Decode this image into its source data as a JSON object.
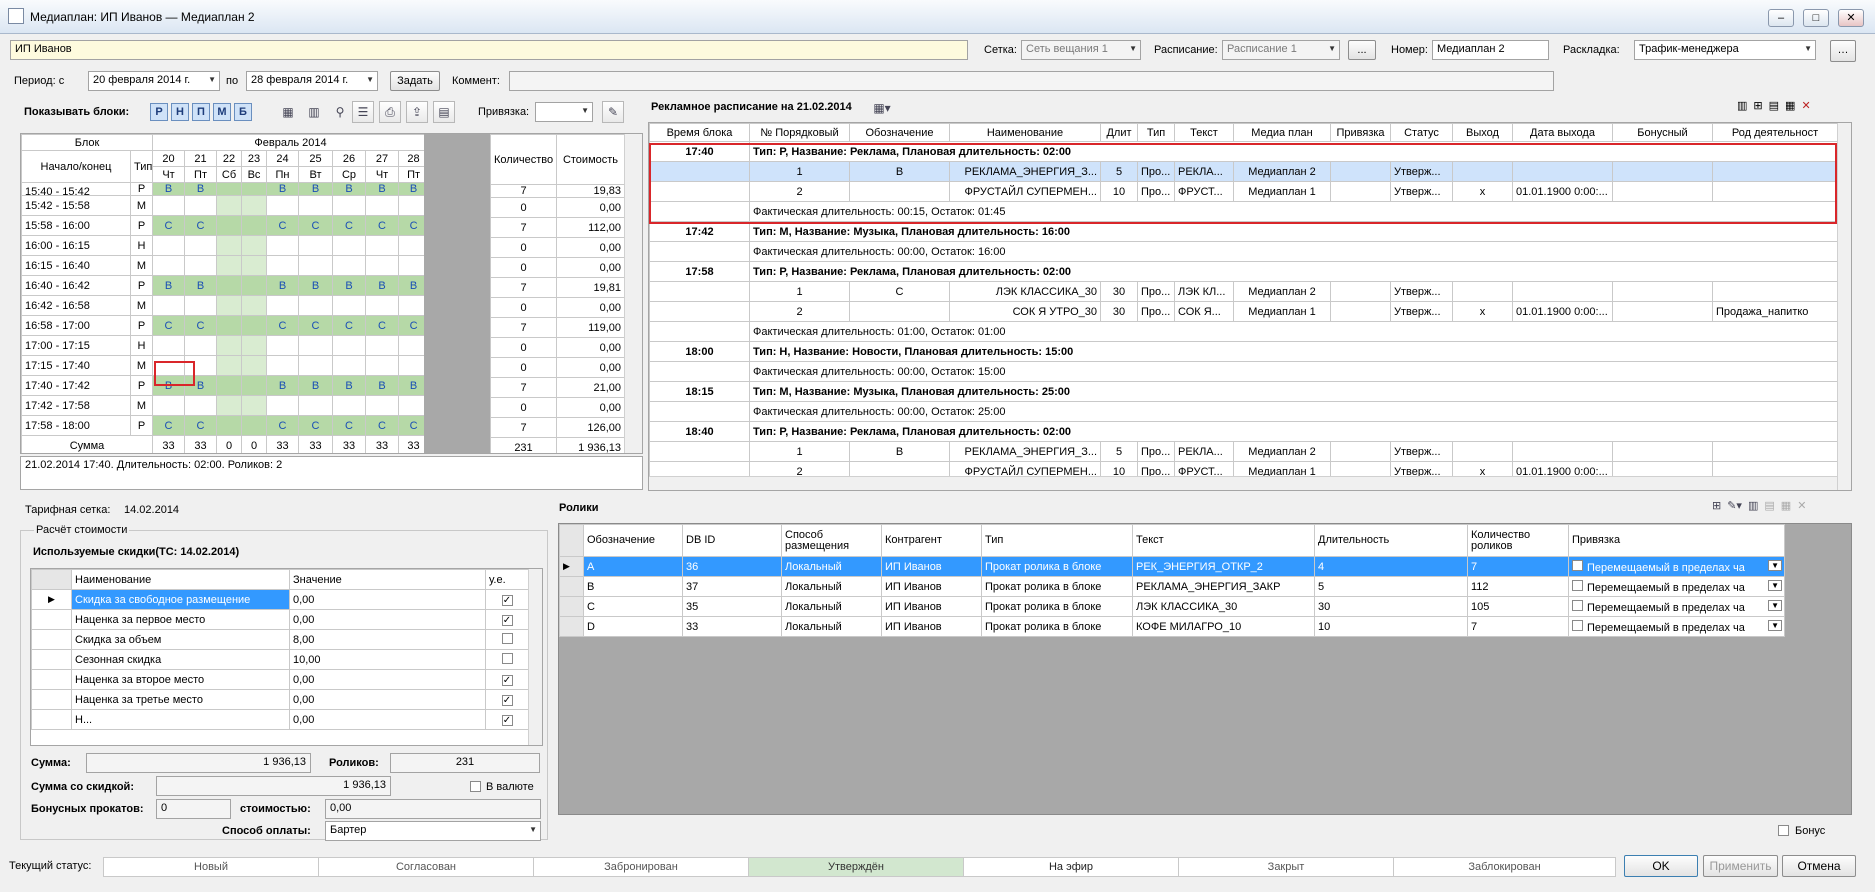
{
  "window": {
    "title": "Медиаплан: ИП Иванов — Медиаплан 2"
  },
  "header": {
    "client": "ИП Иванов",
    "grid_label": "Сетка:",
    "grid_value": "Сеть вещания 1",
    "schedule_label": "Расписание:",
    "schedule_value": "Расписание 1",
    "dots": "...",
    "number_label": "Номер:",
    "number_value": "Медиаплан 2",
    "layout_label": "Раскладка:",
    "layout_value": "Трафик-менеджера",
    "period_label": "Период: с",
    "date_from": "20 февраля 2014 г.",
    "to_label": "по",
    "date_to": "28 февраля 2014 г.",
    "set_button": "Задать",
    "comment_label": "Коммент:",
    "comment_value": ""
  },
  "blocks_toolbar": {
    "show_label": "Показывать блоки:",
    "buttons": [
      "Р",
      "Н",
      "П",
      "М",
      "Б"
    ],
    "binding_label": "Привязка:"
  },
  "block_grid": {
    "col_block": "Блок",
    "col_startend": "Начало/конец",
    "col_type": "Тип",
    "month": "Февраль 2014",
    "days": [
      "20",
      "21",
      "22",
      "23",
      "24",
      "25",
      "26",
      "27",
      "28"
    ],
    "weekdays": [
      "Чт",
      "Пт",
      "Сб",
      "Вс",
      "Пн",
      "Вт",
      "Ср",
      "Чт",
      "Пт"
    ],
    "col_qty": "Количество",
    "col_cost": "Стоимость",
    "partial_row": {
      "time": "15:40 - 15:42",
      "type": "Р",
      "cells": [
        "В",
        "В",
        "",
        "",
        "В",
        "В",
        "В",
        "В",
        "В"
      ],
      "qty": "7",
      "cost": "19,83"
    },
    "rows": [
      {
        "time": "15:42 - 15:58",
        "type": "М",
        "cells": [
          "",
          "",
          "",
          "",
          "",
          "",
          "",
          "",
          ""
        ],
        "qty": "0",
        "cost": "0,00"
      },
      {
        "time": "15:58 - 16:00",
        "type": "Р",
        "cells": [
          "С",
          "С",
          "",
          "",
          "С",
          "С",
          "С",
          "С",
          "С"
        ],
        "qty": "7",
        "cost": "112,00"
      },
      {
        "time": "16:00 - 16:15",
        "type": "Н",
        "cells": [
          "",
          "",
          "",
          "",
          "",
          "",
          "",
          "",
          ""
        ],
        "qty": "0",
        "cost": "0,00"
      },
      {
        "time": "16:15 - 16:40",
        "type": "М",
        "cells": [
          "",
          "",
          "",
          "",
          "",
          "",
          "",
          "",
          ""
        ],
        "qty": "0",
        "cost": "0,00"
      },
      {
        "time": "16:40 - 16:42",
        "type": "Р",
        "cells": [
          "В",
          "В",
          "",
          "",
          "В",
          "В",
          "В",
          "В",
          "В"
        ],
        "qty": "7",
        "cost": "19,81"
      },
      {
        "time": "16:42 - 16:58",
        "type": "М",
        "cells": [
          "",
          "",
          "",
          "",
          "",
          "",
          "",
          "",
          ""
        ],
        "qty": "0",
        "cost": "0,00"
      },
      {
        "time": "16:58 - 17:00",
        "type": "Р",
        "cells": [
          "С",
          "С",
          "",
          "",
          "С",
          "С",
          "С",
          "С",
          "С"
        ],
        "qty": "7",
        "cost": "119,00"
      },
      {
        "time": "17:00 - 17:15",
        "type": "Н",
        "cells": [
          "",
          "",
          "",
          "",
          "",
          "",
          "",
          "",
          ""
        ],
        "qty": "0",
        "cost": "0,00"
      },
      {
        "time": "17:15 - 17:40",
        "type": "М",
        "cells": [
          "",
          "",
          "",
          "",
          "",
          "",
          "",
          "",
          ""
        ],
        "qty": "0",
        "cost": "0,00"
      },
      {
        "time": "17:40 - 17:42",
        "type": "Р",
        "cells": [
          "В",
          "В",
          "",
          "",
          "В",
          "В",
          "В",
          "В",
          "В"
        ],
        "qty": "7",
        "cost": "21,00"
      },
      {
        "time": "17:42 - 17:58",
        "type": "М",
        "cells": [
          "",
          "",
          "",
          "",
          "",
          "",
          "",
          "",
          ""
        ],
        "qty": "0",
        "cost": "0,00"
      },
      {
        "time": "17:58 - 18:00",
        "type": "Р",
        "cells": [
          "С",
          "С",
          "",
          "",
          "С",
          "С",
          "С",
          "С",
          "С"
        ],
        "qty": "7",
        "cost": "126,00"
      }
    ],
    "sum": {
      "label": "Сумма",
      "cells": [
        "33",
        "33",
        "0",
        "0",
        "33",
        "33",
        "33",
        "33",
        "33"
      ],
      "qty": "231",
      "cost": "1 936,13"
    },
    "info": "21.02.2014 17:40. Длительность: 02:00. Роликов: 2"
  },
  "schedule": {
    "title": "Рекламное расписание на 21.02.2014",
    "columns": [
      "Время блока",
      "№ Порядковый",
      "Обозначение",
      "Наименование",
      "Длит",
      "Тип",
      "Текст",
      "Медиа план",
      "Привязка",
      "Статус",
      "Выход",
      "Дата выхода",
      "Бонусный",
      "Род деятельност"
    ],
    "rows": [
      {
        "kind": "grp",
        "time": "17:40",
        "text": "Тип: Р, Название: Реклама, Плановая длительность: 02:00"
      },
      {
        "kind": "item",
        "sel": true,
        "cells": [
          "",
          "1",
          "В",
          "РЕКЛАМА_ЭНЕРГИЯ_З...",
          "5",
          "Про...",
          "РЕКЛА...",
          "Медиаплан 2",
          "",
          "Утверж...",
          "",
          "",
          "",
          ""
        ]
      },
      {
        "kind": "item",
        "cells": [
          "",
          "2",
          "",
          "ФРУСТАЙЛ СУПЕРМЕН...",
          "10",
          "Про...",
          "ФРУСТ...",
          "Медиаплан 1",
          "",
          "Утверж...",
          "x",
          "01.01.1900 0:00:...",
          "",
          ""
        ]
      },
      {
        "kind": "fact",
        "text": "Фактическая длительность: 00:15, Остаток: 01:45"
      },
      {
        "kind": "grp",
        "time": "17:42",
        "text": "Тип: М, Название: Музыка, Плановая длительность: 16:00"
      },
      {
        "kind": "fact",
        "text": "Фактическая длительность: 00:00, Остаток: 16:00"
      },
      {
        "kind": "grp",
        "time": "17:58",
        "text": "Тип: Р, Название: Реклама, Плановая длительность: 02:00"
      },
      {
        "kind": "item",
        "cells": [
          "",
          "1",
          "С",
          "ЛЭК КЛАССИКА_30",
          "30",
          "Про...",
          "ЛЭК КЛ...",
          "Медиаплан 2",
          "",
          "Утверж...",
          "",
          "",
          "",
          ""
        ]
      },
      {
        "kind": "item",
        "cells": [
          "",
          "2",
          "",
          "СОК Я УТРО_30",
          "30",
          "Про...",
          "СОК Я...",
          "Медиаплан 1",
          "",
          "Утверж...",
          "x",
          "01.01.1900 0:00:...",
          "",
          "Продажа_напитко"
        ]
      },
      {
        "kind": "fact",
        "text": "Фактическая длительность: 01:00, Остаток: 01:00"
      },
      {
        "kind": "grp",
        "time": "18:00",
        "text": "Тип: Н, Название: Новости, Плановая длительность: 15:00"
      },
      {
        "kind": "fact",
        "text": "Фактическая длительность: 00:00, Остаток: 15:00"
      },
      {
        "kind": "grp",
        "time": "18:15",
        "text": "Тип: М, Название: Музыка, Плановая длительность: 25:00"
      },
      {
        "kind": "fact",
        "text": "Фактическая длительность: 00:00, Остаток: 25:00"
      },
      {
        "kind": "grp",
        "time": "18:40",
        "text": "Тип: Р, Название: Реклама, Плановая длительность: 02:00"
      },
      {
        "kind": "item",
        "cells": [
          "",
          "1",
          "В",
          "РЕКЛАМА_ЭНЕРГИЯ_З...",
          "5",
          "Про...",
          "РЕКЛА...",
          "Медиаплан 2",
          "",
          "Утверж...",
          "",
          "",
          "",
          ""
        ]
      },
      {
        "kind": "item",
        "cells": [
          "",
          "2",
          "",
          "ФРУСТАЙЛ СУПЕРМЕН...",
          "10",
          "Про...",
          "ФРУСТ...",
          "Медиаплан 1",
          "",
          "Утверж...",
          "x",
          "01.01.1900 0:00:...",
          "",
          ""
        ]
      }
    ]
  },
  "pricing": {
    "tariff_label": "Тарифная сетка:",
    "tariff_value": "14.02.2014",
    "group_label": "Расчёт стоимости",
    "discounts_title": "Используемые скидки(ТС: 14.02.2014)",
    "cols": [
      "Наименование",
      "Значение",
      "у.е."
    ],
    "rows": [
      {
        "name": "Скидка за свободное размещение",
        "value": "0,00",
        "checked": true,
        "sel": true
      },
      {
        "name": "Наценка за первое место",
        "value": "0,00",
        "checked": true
      },
      {
        "name": "Скидка за объем",
        "value": "8,00",
        "checked": false
      },
      {
        "name": "Сезонная скидка",
        "value": "10,00",
        "checked": false
      },
      {
        "name": "Наценка за второе место",
        "value": "0,00",
        "checked": true
      },
      {
        "name": "Наценка за третье место",
        "value": "0,00",
        "checked": true
      },
      {
        "name": "Н...",
        "value": "0,00",
        "checked": true
      }
    ],
    "sum_label": "Сумма:",
    "sum_value": "1 936,13",
    "rolls_label": "Роликов:",
    "rolls_value": "231",
    "disc_sum_label": "Сумма со скидкой:",
    "disc_sum_value": "1 936,13",
    "currency_label": "В валюте",
    "bonus_label": "Бонусных прокатов:",
    "bonus_value": "0",
    "cost_label": "стоимостью:",
    "cost_value": "0,00",
    "pay_label": "Способ оплаты:",
    "pay_value": "Бартер"
  },
  "rollers": {
    "title": "Ролики",
    "cols": [
      "Обозначение",
      "DB ID",
      "Способ размещения",
      "Контрагент",
      "Тип",
      "Текст",
      "Длительность",
      "Количество роликов",
      "Привязка"
    ],
    "rows": [
      {
        "sel": true,
        "cells": [
          "A",
          "36",
          "Локальный",
          "ИП Иванов",
          "Прокат ролика в блоке",
          "РЕК_ЭНЕРГИЯ_ОТКР_2",
          "4",
          "7",
          "Перемещаемый  в  пределах ча"
        ]
      },
      {
        "cells": [
          "B",
          "37",
          "Локальный",
          "ИП Иванов",
          "Прокат ролика в блоке",
          "РЕКЛАМА_ЭНЕРГИЯ_ЗАКР",
          "5",
          "112",
          "Перемещаемый  в  пределах ча"
        ]
      },
      {
        "cells": [
          "C",
          "35",
          "Локальный",
          "ИП Иванов",
          "Прокат ролика в блоке",
          "ЛЭК КЛАССИКА_30",
          "30",
          "105",
          "Перемещаемый  в  пределах ча"
        ]
      },
      {
        "cells": [
          "D",
          "33",
          "Локальный",
          "ИП Иванов",
          "Прокат ролика в блоке",
          "КОФЕ МИЛАГРО_10",
          "10",
          "7",
          "Перемещаемый  в  пределах ча"
        ]
      }
    ],
    "bonus_label": "Бонус"
  },
  "status": {
    "label": "Текущий статус:",
    "items": [
      "Новый",
      "Согласован",
      "Забронирован",
      "Утверждён",
      "На эфир",
      "Закрыт",
      "Заблокирован"
    ],
    "active_index": 3
  },
  "footer": {
    "ok": "OK",
    "apply": "Применить",
    "cancel": "Отмена"
  }
}
